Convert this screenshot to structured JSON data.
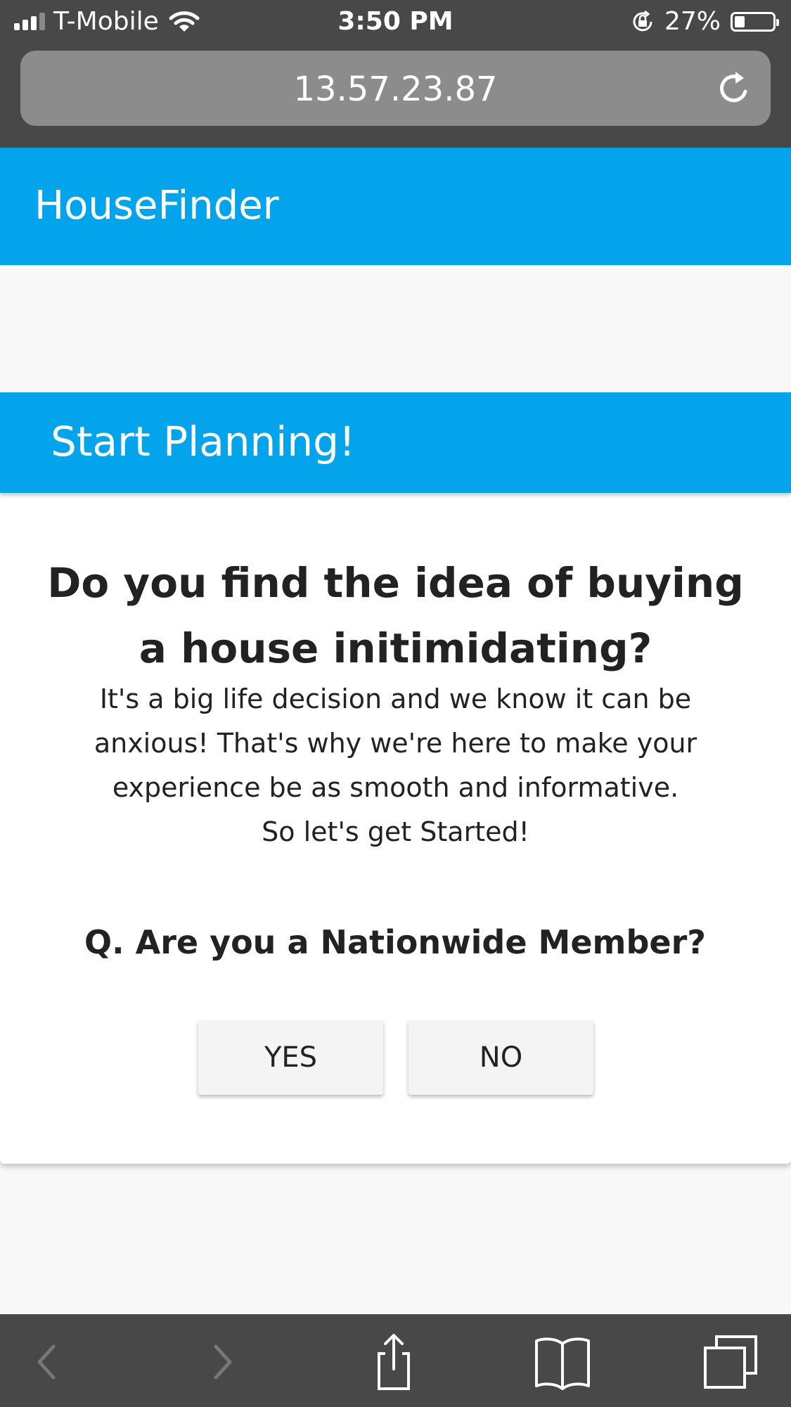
{
  "status_bar": {
    "carrier": "T-Mobile",
    "time": "3:50 PM",
    "battery_percent": "27%",
    "battery_level": 0.27,
    "icons": [
      "signal-icon",
      "wifi-icon",
      "rotation-lock-icon",
      "battery-icon"
    ]
  },
  "browser": {
    "url": "13.57.23.87",
    "reload_icon": "reload-icon",
    "toolbar_icons": [
      "back-icon",
      "forward-icon",
      "share-icon",
      "bookmarks-icon",
      "tabs-icon"
    ]
  },
  "app": {
    "title": "HouseFinder",
    "accent_color": "#03a4ec"
  },
  "card": {
    "header": "Start Planning!",
    "headline": "Do you find the idea of buying a house initimidating?",
    "body_lines": [
      "It's a big life decision and we know it can be",
      "anxious! That's why we're here to make your",
      "experience be as smooth and informative.",
      "So let's get Started!"
    ],
    "question": "Q. Are you a Nationwide Member?",
    "buttons": {
      "yes": "YES",
      "no": "NO"
    }
  }
}
